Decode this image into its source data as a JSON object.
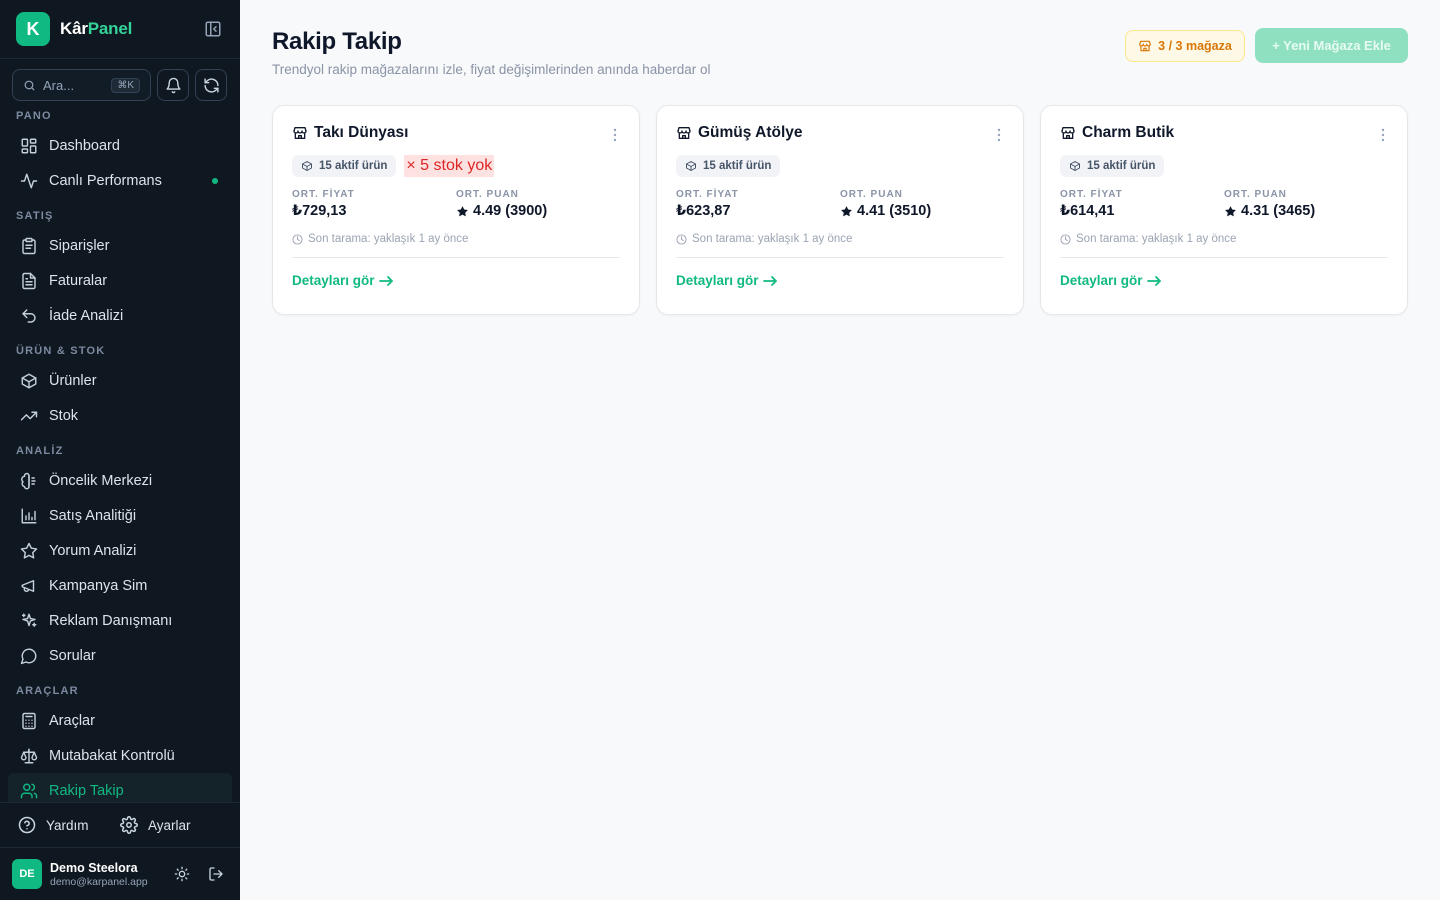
{
  "brand": {
    "logo_letter": "K",
    "name_part1": "Kâr",
    "name_part2": "Panel"
  },
  "search": {
    "placeholder": "Ara...",
    "shortcut": "⌘K"
  },
  "nav": {
    "sections": [
      {
        "label": "PANO",
        "items": [
          {
            "label": "Dashboard",
            "icon": "grid-icon"
          },
          {
            "label": "Canlı Performans",
            "icon": "activity-icon",
            "live": true
          }
        ]
      },
      {
        "label": "SATIŞ",
        "items": [
          {
            "label": "Siparişler",
            "icon": "clipboard-icon"
          },
          {
            "label": "Faturalar",
            "icon": "file-text-icon"
          },
          {
            "label": "İade Analizi",
            "icon": "undo-icon"
          }
        ]
      },
      {
        "label": "ÜRÜN & STOK",
        "items": [
          {
            "label": "Ürünler",
            "icon": "package-icon"
          },
          {
            "label": "Stok",
            "icon": "trending-up-icon"
          }
        ]
      },
      {
        "label": "ANALİZ",
        "items": [
          {
            "label": "Öncelik Merkezi",
            "icon": "brain-icon"
          },
          {
            "label": "Satış Analitiği",
            "icon": "bar-chart-icon"
          },
          {
            "label": "Yorum Analizi",
            "icon": "star-icon"
          },
          {
            "label": "Kampanya Sim",
            "icon": "megaphone-icon"
          },
          {
            "label": "Reklam Danışmanı",
            "icon": "sparkles-icon"
          },
          {
            "label": "Sorular",
            "icon": "message-circle-icon"
          }
        ]
      },
      {
        "label": "ARAÇLAR",
        "items": [
          {
            "label": "Araçlar",
            "icon": "calculator-icon"
          },
          {
            "label": "Mutabakat Kontrolü",
            "icon": "scale-icon"
          },
          {
            "label": "Rakip Takip",
            "icon": "users-icon",
            "active": true
          }
        ]
      }
    ]
  },
  "footer": {
    "help": "Yardım",
    "settings": "Ayarlar"
  },
  "user": {
    "initials": "DE",
    "name": "Demo Steelora",
    "email": "demo@karpanel.app"
  },
  "page": {
    "title": "Rakip Takip",
    "subtitle": "Trendyol rakip mağazalarını izle, fiyat değişimlerinden anında haberdar ol",
    "store_count": "3 / 3 mağaza",
    "add_store": "+ Yeni Mağaza Ekle"
  },
  "labels": {
    "avg_price": "ORT. FİYAT",
    "avg_rating": "ORT. PUAN",
    "details": "Detayları gör"
  },
  "stores": [
    {
      "name": "Takı Dünyası",
      "active_products": "15 aktif ürün",
      "out_of_stock": "× 5 stok yok",
      "avg_price": "₺729,13",
      "avg_rating": "4.49 (3900)",
      "last_scan": "Son tarama: yaklaşık 1 ay önce"
    },
    {
      "name": "Gümüş Atölye",
      "active_products": "15 aktif ürün",
      "out_of_stock": "",
      "avg_price": "₺623,87",
      "avg_rating": "4.41 (3510)",
      "last_scan": "Son tarama: yaklaşık 1 ay önce"
    },
    {
      "name": "Charm Butik",
      "active_products": "15 aktif ürün",
      "out_of_stock": "",
      "avg_price": "₺614,41",
      "avg_rating": "4.31 (3465)",
      "last_scan": "Son tarama: yaklaşık 1 ay önce"
    }
  ],
  "colors": {
    "accent": "#10b981",
    "sidebar_bg": "#0f1720",
    "warning": "#d97706",
    "danger": "#dc2626"
  }
}
